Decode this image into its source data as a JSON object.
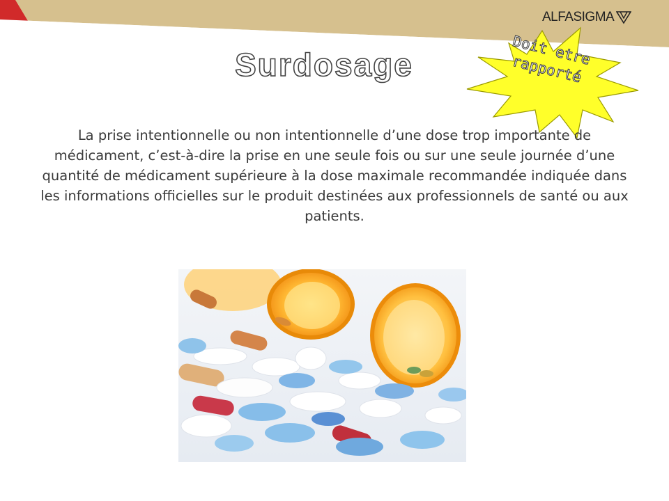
{
  "slide": {
    "title": "Surdosage",
    "callout": "Doit etre rapporté",
    "definition": "La prise intentionnelle ou non intentionnelle d’une dose trop importante de médicament, c’est-à-dire la prise en une seule fois ou sur une seule journée d’une quantité de médicament supérieure à la dose maximale recommandée indiquée dans les informations officielles sur le produit destinées aux professionnels de santé ou aux patients."
  },
  "branding": {
    "logo_text": "ALFASIGMA",
    "band_color": "#d6c08e",
    "accent_color": "#d12a2a"
  },
  "icons": {
    "logo_mark": "triangle-v-logo-icon",
    "photo": "spilled-pills-bottles-image"
  }
}
